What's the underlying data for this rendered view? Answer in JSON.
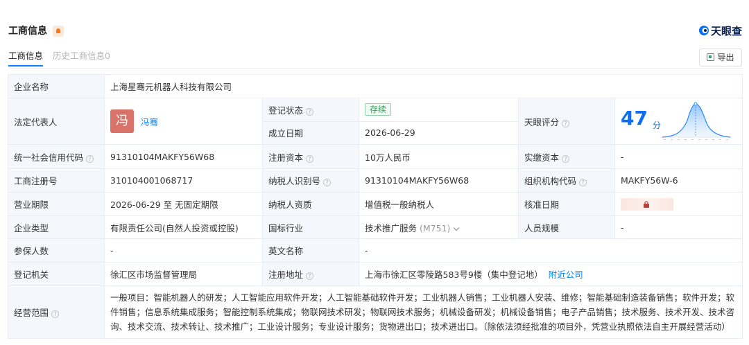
{
  "header": {
    "title": "工商信息",
    "brand": "天眼查"
  },
  "tabs": [
    {
      "label": "工商信息"
    },
    {
      "label": "历史工商信息0"
    }
  ],
  "export_label": "导出",
  "labels": {
    "company_name": "企业名称",
    "legal_rep": "法定代表人",
    "reg_status": "登记状态",
    "established": "成立日期",
    "tianyan_score": "天眼评分",
    "credit_code": "统一社会信用代码",
    "reg_capital": "注册资本",
    "paid_capital": "实缴资本",
    "reg_number": "工商注册号",
    "taxpayer_id": "纳税人识别号",
    "org_code": "组织机构代码",
    "business_term": "营业期限",
    "taxpayer_qual": "纳税人资质",
    "approval_date": "核准日期",
    "company_type": "企业类型",
    "industry": "国标行业",
    "staff_size": "人员规模",
    "insured": "参保人数",
    "english_name": "英文名称",
    "reg_authority": "登记机关",
    "reg_address": "注册地址",
    "business_scope": "经营范围"
  },
  "values": {
    "company_name": "上海星骞元机器人科技有限公司",
    "legal_rep_avatar": "冯",
    "legal_rep": "冯骞",
    "reg_status": "存续",
    "established": "2026-06-29",
    "score": "47",
    "score_unit": "分",
    "credit_code": "91310104MAKFY56W68",
    "reg_capital": "10万人民币",
    "paid_capital": "-",
    "reg_number": "310104001068717",
    "taxpayer_id": "91310104MAKFY56W68",
    "org_code": "MAKFY56W-6",
    "business_term": "2026-06-29 至 无固定期限",
    "taxpayer_qual": "增值税一般纳税人",
    "company_type": "有限责任公司(自然人投资或控股)",
    "industry": "技术推广服务",
    "industry_code": "(M751)",
    "staff_size": "-",
    "insured": "-",
    "english_name": "-",
    "reg_authority": "徐汇区市场监督管理局",
    "reg_address": "上海市徐汇区零陵路583号9楼（集中登记地）",
    "nearby_link": "附近公司",
    "business_scope": "一般项目：智能机器人的研发；人工智能应用软件开发；人工智能基础软件开发；工业机器人销售；工业机器人安装、维修；智能基础制造装备销售；软件开发；软件销售；信息系统集成服务；智能控制系统集成；物联网技术研发；物联网技术服务；机械设备研发；机械设备销售；电子产品销售；技术服务、技术开发、技术咨询、技术交流、技术转让、技术推广；工业设计服务；专业设计服务；货物进出口；技术进出口。（除依法须经批准的项目外，凭营业执照依法自主开展经营活动）"
  },
  "colors": {
    "accent": "#0084ff",
    "score": "#0a6ff0",
    "status": "#2ea35a",
    "label_bg": "#f4f7fb"
  },
  "icons": [
    "pro-badge-icon",
    "tianyancha-logo-icon",
    "export-icon",
    "help-icon",
    "lock-icon",
    "chevron-down-icon"
  ]
}
